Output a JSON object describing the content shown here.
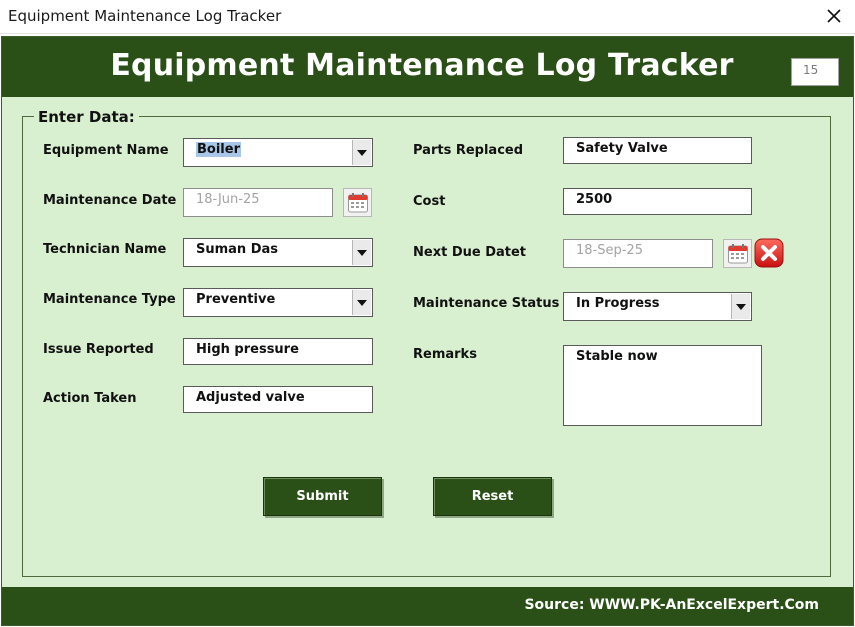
{
  "window": {
    "title": "Equipment Maintenance Log Tracker"
  },
  "header": {
    "title": "Equipment Maintenance Log Tracker",
    "record_id": "15"
  },
  "frame": {
    "caption": "Enter Data:"
  },
  "fields": {
    "equipment_name": {
      "label": "Equipment Name",
      "value": "Boiler"
    },
    "maintenance_date": {
      "label": "Maintenance Date",
      "value": "18-Jun-25"
    },
    "technician_name": {
      "label": "Technician Name",
      "value": "Suman Das"
    },
    "maintenance_type": {
      "label": "Maintenance Type",
      "value": "Preventive"
    },
    "issue_reported": {
      "label": "Issue Reported",
      "value": "High pressure"
    },
    "action_taken": {
      "label": "Action Taken",
      "value": "Adjusted valve"
    },
    "parts_replaced": {
      "label": "Parts Replaced",
      "value": "Safety Valve"
    },
    "cost": {
      "label": "Cost",
      "value": "2500"
    },
    "next_due_date": {
      "label": "Next Due Datet",
      "value": "18-Sep-25"
    },
    "maintenance_status": {
      "label": "Maintenance Status",
      "value": "In Progress"
    },
    "remarks": {
      "label": "Remarks",
      "value": "Stable now"
    }
  },
  "buttons": {
    "submit": "Submit",
    "reset": "Reset"
  },
  "footer": {
    "source": "Source: WWW.PK-AnExcelExpert.Com"
  },
  "icons": {
    "calendar": "calendar-icon",
    "clear": "clear-date-icon",
    "close": "close-icon",
    "dropdown": "chevron-down-icon"
  },
  "colors": {
    "primary_green": "#2a4f17",
    "form_background": "#d9f0d0",
    "selection": "#a8c7e8",
    "clear_red": "#e02020"
  }
}
